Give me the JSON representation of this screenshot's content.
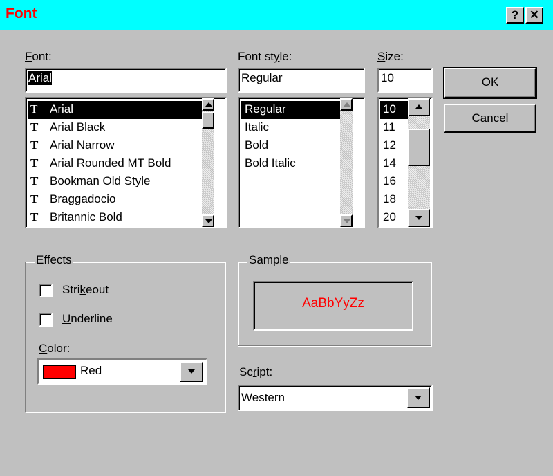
{
  "window": {
    "title": "Font",
    "help_label": "?",
    "close_label": "✕"
  },
  "font": {
    "label": "Font:",
    "value": "Arial",
    "items": [
      {
        "glyph": "T",
        "name": "Arial"
      },
      {
        "glyph": "T",
        "name": "Arial Black"
      },
      {
        "glyph": "T",
        "name": "Arial Narrow"
      },
      {
        "glyph": "T",
        "name": "Arial Rounded MT Bold"
      },
      {
        "glyph": "T",
        "name": "Bookman Old Style"
      },
      {
        "glyph": "T",
        "name": "Braggadocio"
      },
      {
        "glyph": "T",
        "name": "Britannic Bold"
      }
    ],
    "selected_index": 0
  },
  "style": {
    "label": "Font style:",
    "value": "Regular",
    "items": [
      "Regular",
      "Italic",
      "Bold",
      "Bold Italic"
    ],
    "selected_index": 0
  },
  "size": {
    "label": "Size:",
    "value": "10",
    "items": [
      "10",
      "11",
      "12",
      "14",
      "16",
      "18",
      "20"
    ],
    "selected_index": 0
  },
  "buttons": {
    "ok": "OK",
    "cancel": "Cancel"
  },
  "effects": {
    "label": "Effects",
    "strikeout": "Strikeout",
    "underline": "Underline",
    "strikeout_checked": false,
    "underline_checked": false,
    "color_label": "Color:",
    "color_value": "Red",
    "color_swatch": "#ff0000"
  },
  "sample": {
    "label": "Sample",
    "text": "AaBbYyZz",
    "color": "#ff0000"
  },
  "script": {
    "label": "Script:",
    "value": "Western"
  }
}
